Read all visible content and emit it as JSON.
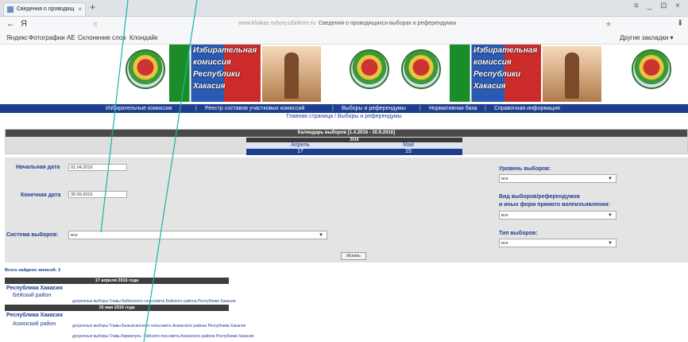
{
  "browser": {
    "tab_title": "Сведения о проводящ",
    "tab_close": "×",
    "new_tab": "+",
    "window_controls": "≡ _ ⊡ ×",
    "back": "←",
    "browser_logo": "Я",
    "reload": "c",
    "url_host": "www.khakas.vybory.izbirkom.ru",
    "url_title": "Сведения о проводящихся выборах и референдумах",
    "star": "★",
    "download": "⬇",
    "bookmarks": [
      "Яндекс",
      "Фотографии АЕ",
      "Склонение слов",
      "Клондайк"
    ],
    "other_bookmarks": "Другие закладки ▾"
  },
  "site": {
    "banner_text": [
      "Избирательная",
      "комиссия",
      "Республики",
      "Хакасия"
    ],
    "nav": [
      "Избирательные комиссии",
      "Реестр составов участковых комиссий",
      "Выборы и референдумы",
      "Нормативная база",
      "Справочная информация"
    ],
    "nav_sep": "|",
    "breadcrumb": "Главная страница / Выборы и референдумы"
  },
  "calendar": {
    "title": "Календарь выборов [1.4.2016 - 30.9.2016]",
    "year": "2016",
    "months": [
      {
        "name": "Апрель",
        "count": "17"
      },
      {
        "name": "Май",
        "count": "15"
      }
    ]
  },
  "filters": {
    "start_label": "Начальная дата",
    "start_value": "01.04.2016",
    "end_label": "Конечная дата",
    "end_value": "30.09.2016",
    "system_label": "Система выборов:",
    "system_value": "все",
    "level_label": "Уровень выборов:",
    "level_value": "все",
    "type_label_1": "Вид выборов/референдумов",
    "type_label_2": "и иных форм прямого волеизъявления:",
    "type_value": "все",
    "kind_label": "Тип выборов:",
    "kind_value": "все",
    "search_button": "Искать"
  },
  "results": {
    "found": "Всего найдено записей: 3",
    "groups": [
      {
        "date": "17 апреля 2016 года",
        "region": "Республика Хакасия",
        "district": "Бейский район",
        "elections": [
          "досрочные выборы Главы Бабинского сельсовета Бейского района Республики Хакасия"
        ]
      },
      {
        "date": "15 мая 2016 года",
        "region": "Республика Хакасия",
        "district": "Аскизский район",
        "elections": [
          "досрочные выборы Главы Балыксинского сельсовета Аскизского района Республики Хакасия",
          "досрочные выборы Главы Бирикчуль -Тейского поссовета Аскизского района Республики Хакасия"
        ]
      }
    ]
  },
  "colors": {
    "accent": "#1e3f8f",
    "cursor": "#16b5a4"
  }
}
